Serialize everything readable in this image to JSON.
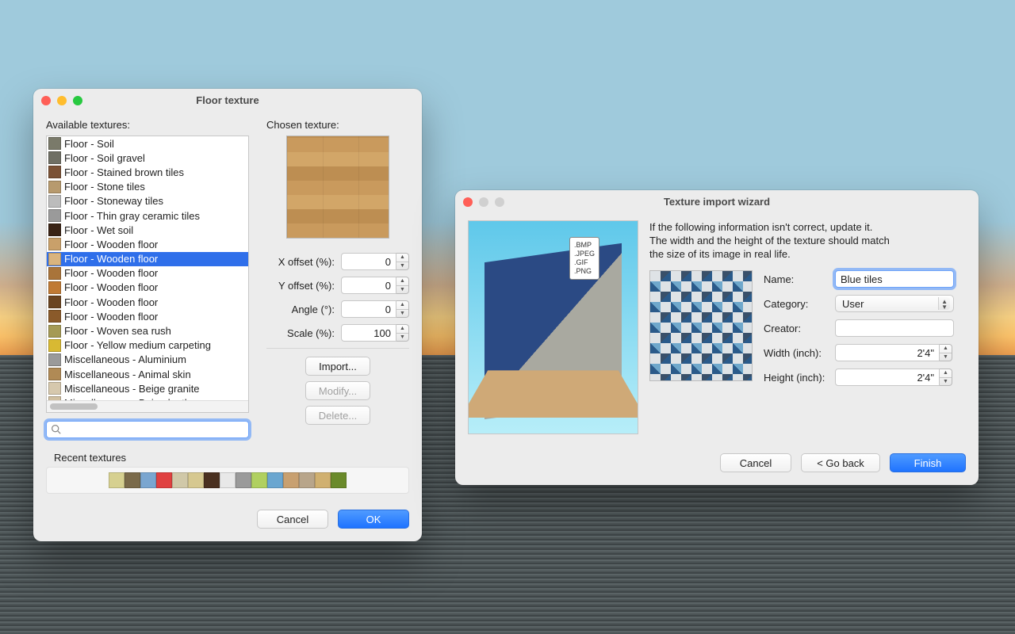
{
  "floorDialog": {
    "title": "Floor texture",
    "availableLabel": "Available textures:",
    "chosenLabel": "Chosen texture:",
    "textures": [
      {
        "name": "Floor - Soil",
        "color": "#7a7a6a"
      },
      {
        "name": "Floor - Soil gravel",
        "color": "#6f6f64"
      },
      {
        "name": "Floor - Stained brown tiles",
        "color": "#7b5236"
      },
      {
        "name": "Floor - Stone tiles",
        "color": "#b79a6e"
      },
      {
        "name": "Floor - Stoneway tiles",
        "color": "#bcbcbc"
      },
      {
        "name": "Floor - Thin gray ceramic tiles",
        "color": "#9a9a9a"
      },
      {
        "name": "Floor - Wet soil",
        "color": "#3a2416"
      },
      {
        "name": "Floor - Wooden floor",
        "color": "#c9a06a"
      },
      {
        "name": "Floor - Wooden floor",
        "color": "#d9b47f",
        "selected": true
      },
      {
        "name": "Floor - Wooden floor",
        "color": "#a9743a"
      },
      {
        "name": "Floor - Wooden floor",
        "color": "#c07a34"
      },
      {
        "name": "Floor - Wooden floor",
        "color": "#6a4420"
      },
      {
        "name": "Floor - Wooden floor",
        "color": "#8a5a2a"
      },
      {
        "name": "Floor - Woven sea rush",
        "color": "#a59a55"
      },
      {
        "name": "Floor - Yellow medium carpeting",
        "color": "#d8b933"
      },
      {
        "name": "Miscellaneous - Aluminium",
        "color": "#9a9a9a"
      },
      {
        "name": "Miscellaneous - Animal skin",
        "color": "#b08a55"
      },
      {
        "name": "Miscellaneous - Beige granite",
        "color": "#d6c8ad"
      },
      {
        "name": "Miscellaneous - Beige leather",
        "color": "#d0bfa0"
      }
    ],
    "xoffsetLabel": "X offset (%):",
    "xoffset": "0",
    "yoffsetLabel": "Y offset (%):",
    "yoffset": "0",
    "angleLabel": "Angle (°):",
    "angle": "0",
    "scaleLabel": "Scale (%):",
    "scale": "100",
    "importBtn": "Import...",
    "modifyBtn": "Modify...",
    "deleteBtn": "Delete...",
    "recentLabel": "Recent textures",
    "recentColors": [
      "#d6d090",
      "#7a6a4a",
      "#7aa6d0",
      "#e04040",
      "#d0c8a8",
      "#d6c890",
      "#4a3020",
      "#e8e8e8",
      "#9a9a9a",
      "#b0d060",
      "#6aa6d0",
      "#c8a070",
      "#b8a58a",
      "#d0b070",
      "#6a8a2a"
    ],
    "cancel": "Cancel",
    "ok": "OK"
  },
  "wizard": {
    "title": "Texture import wizard",
    "info1": "If the following information isn't correct, update it.",
    "info2": "The width and the height of the texture should match",
    "info3": "the size of its image in real life.",
    "formats": ".BMP\n.JPEG\n.GIF\n.PNG",
    "nameLabel": "Name:",
    "name": "Blue tiles",
    "categoryLabel": "Category:",
    "category": "User",
    "creatorLabel": "Creator:",
    "creator": "",
    "widthLabel": "Width (inch):",
    "width": "2'4\"",
    "heightLabel": "Height (inch):",
    "height": "2'4\"",
    "cancel": "Cancel",
    "back": "< Go back",
    "finish": "Finish"
  }
}
